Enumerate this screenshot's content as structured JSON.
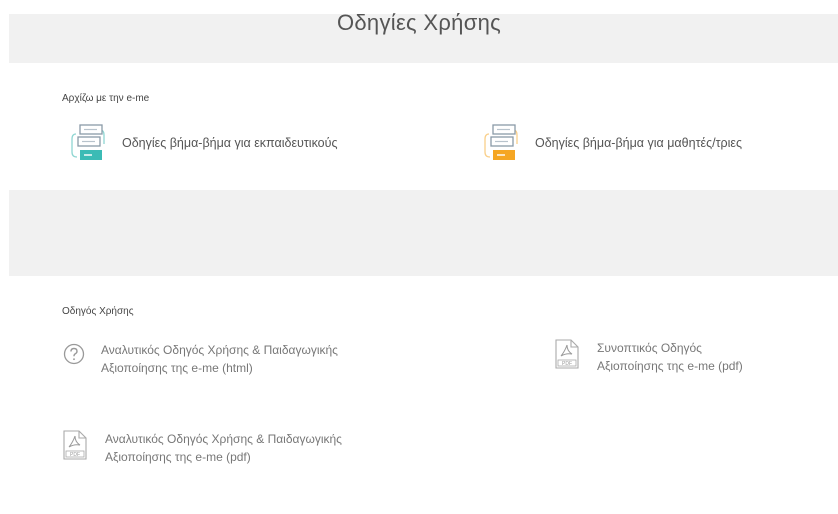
{
  "header": {
    "title": "Οδηγίες Χρήσης"
  },
  "getting_started": {
    "label": "Αρχίζω με την e-me",
    "teachers_link": "Οδηγίες βήμα-βήμα για εκπαιδευτικούς",
    "students_link": "Οδηγίες βήμα-βήμα για μαθητές/τριες",
    "teachers_icon": "teacher-guide-icon",
    "students_icon": "student-guide-icon",
    "teachers_accent": "#3bbbb5",
    "students_accent": "#f5a623"
  },
  "user_guide": {
    "label": "Οδηγός Χρήσης",
    "items": [
      {
        "line1": "Αναλυτικός Οδηγός Χρήσης & Παιδαγωγικής",
        "line2": "Αξιοποίησης της e-me (html)",
        "icon": "help-circle-icon"
      },
      {
        "line1": "Συνοπτικός Οδηγός",
        "line2": "Αξιοποίησης της e-me (pdf)",
        "icon": "pdf-icon"
      },
      {
        "line1": "Αναλυτικός Οδηγός Χρήσης & Παιδαγωγικής",
        "line2": "Αξιοποίησης της e-me (pdf)",
        "icon": "pdf-icon"
      }
    ]
  }
}
